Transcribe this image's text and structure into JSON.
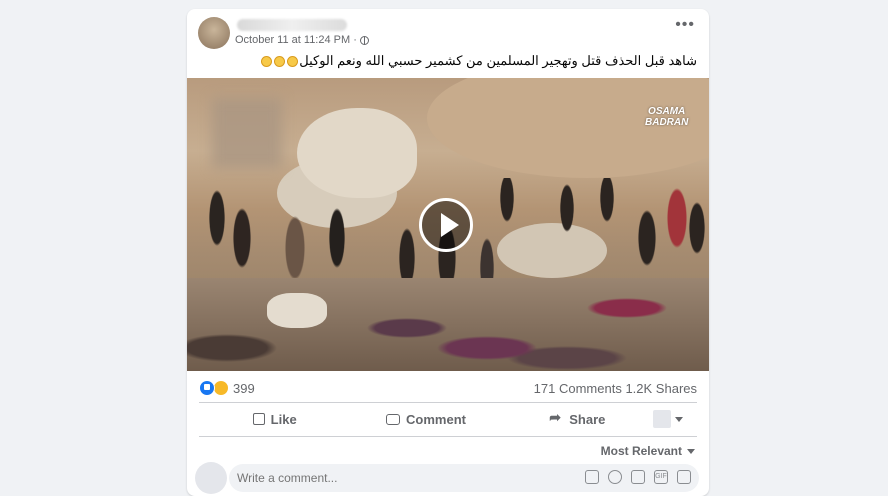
{
  "post": {
    "meta": "October 11 at 11:24 PM ·",
    "caption": "شاهد قبل الحذف قتل وتهجير المسلمين من كشمير حسبي الله ونعم الوكيل",
    "video": {
      "watermark_line1": "OSAMA",
      "watermark_line2": "BADRAN"
    }
  },
  "stats": {
    "reaction_count": "399",
    "comments": "171 Comments",
    "shares": "1.2K Shares"
  },
  "actions": {
    "like": "Like",
    "comment": "Comment",
    "share": "Share"
  },
  "sort": {
    "label": "Most Relevant"
  },
  "comment_box": {
    "placeholder": "Write a comment..."
  },
  "colors": {
    "like_blue": "#1877f2",
    "muted": "#65676b",
    "background": "#f0f2f5"
  }
}
